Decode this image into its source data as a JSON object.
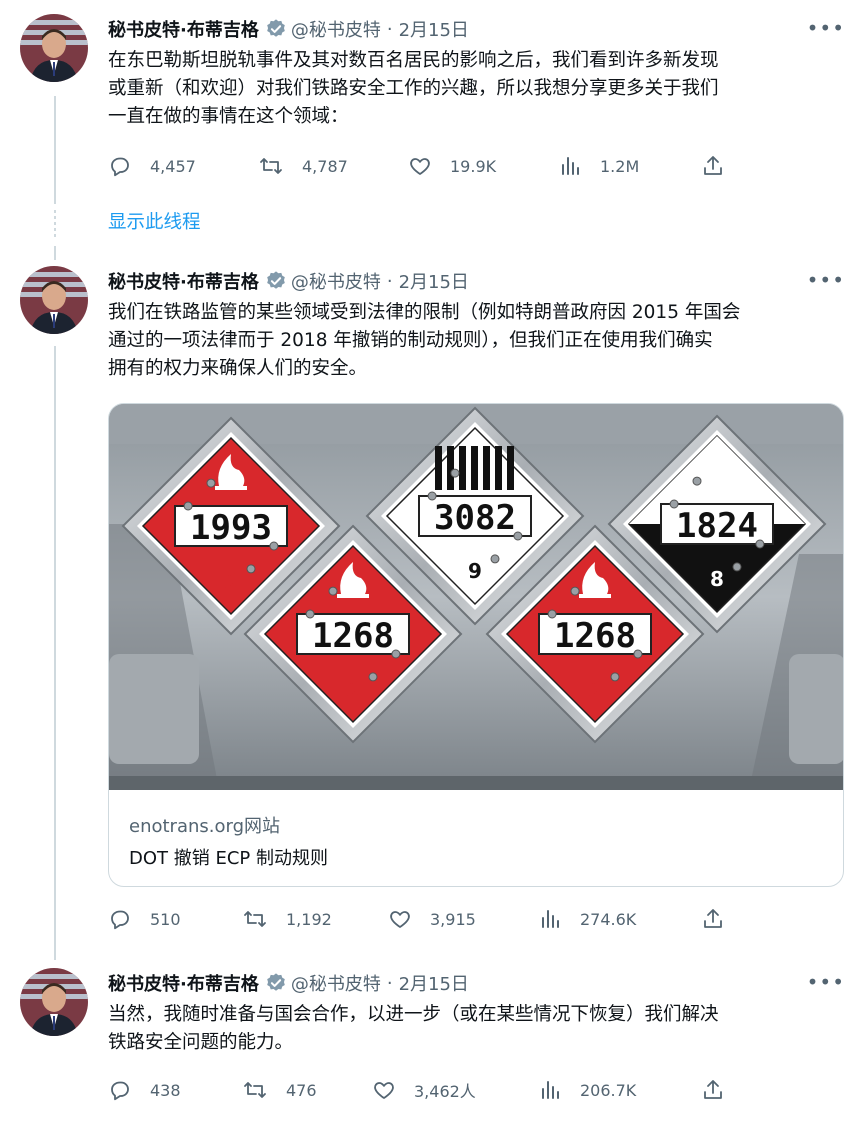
{
  "tweets": [
    {
      "author_name": "秘书皮特·布蒂吉格",
      "handle": "@秘书皮特",
      "separator": "·",
      "date": "2月15日",
      "text_lines": [
        "在东巴勒斯坦脱轨事件及其对数百名居民的影响之后，我们看到许多新发现",
        "或重新（和欢迎）对我们铁路安全工作的兴趣，所以我想分享更多关于我们",
        "一直在做的事情在这个领域："
      ],
      "replies": "4,457",
      "retweets": "4,787",
      "likes": "19.9K",
      "views": "1.2M"
    },
    {
      "author_name": "秘书皮特·布蒂吉格",
      "handle": "@秘书皮特",
      "separator": "·",
      "date": "2月15日",
      "text_lines": [
        "我们在铁路监管的某些领域受到法律的限制（例如特朗普政府因 2015 年国会",
        "通过的一项法律而于 2018 年撤销的制动规则），但我们正在使用我们确实",
        "拥有的权力来确保人们的安全。"
      ],
      "replies": "510",
      "retweets": "1,192",
      "likes": "3,915",
      "views": "274.6K"
    },
    {
      "author_name": "秘书皮特·布蒂吉格",
      "handle": "@秘书皮特",
      "separator": "·",
      "date": "2月15日",
      "text_lines": [
        "当然，我随时准备与国会合作，以进一步（或在某些情况下恢复）我们解决",
        "铁路安全问题的能力。"
      ],
      "replies": "438",
      "retweets": "476",
      "likes": "3,462人",
      "views": "206.7K"
    }
  ],
  "show_thread_label": "显示此线程",
  "more_label": "•••",
  "card": {
    "domain": "enotrans.org网站",
    "title": "DOT 撤销 ECP 制动规则",
    "placards": [
      {
        "number": "1993",
        "class": "3",
        "color": "#d8282c"
      },
      {
        "number": "3082",
        "class": "9",
        "color": "#ffffff"
      },
      {
        "number": "1824",
        "class": "8",
        "color": "#111111"
      },
      {
        "number": "1268",
        "class": "3",
        "color": "#d8282c"
      },
      {
        "number": "1268",
        "class": "3",
        "color": "#d8282c"
      }
    ]
  },
  "colors": {
    "accent": "#1d9bf0",
    "secondary_text": "#536471",
    "verified_badge": "#829aab"
  },
  "icons": [
    "reply-icon",
    "retweet-icon",
    "like-icon",
    "views-icon",
    "share-icon",
    "verified-icon",
    "more-icon"
  ]
}
